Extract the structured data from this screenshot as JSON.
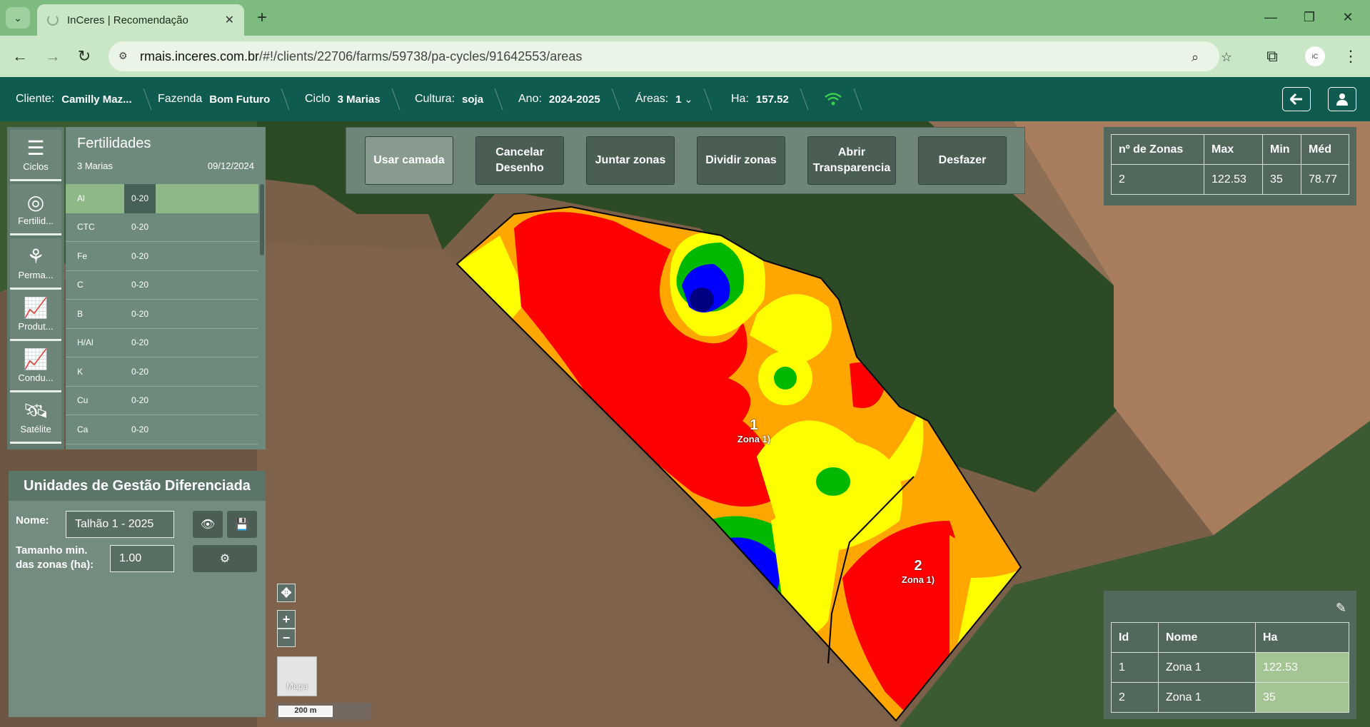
{
  "browser": {
    "tab_title": "InCeres | Recomendação",
    "url_host": "rmais.inceres.com.br",
    "url_path": "/#!/clients/22706/farms/59738/pa-cycles/91642553/areas"
  },
  "header": {
    "cliente_label": "Cliente:",
    "cliente_value": "Camilly Maz...",
    "fazenda_label": "Fazenda",
    "fazenda_value": "Bom Futuro",
    "ciclo_label": "Ciclo",
    "ciclo_value": "3 Marias",
    "cultura_label": "Cultura:",
    "cultura_value": "soja",
    "ano_label": "Ano:",
    "ano_value": "2024-2025",
    "areas_label": "Áreas:",
    "areas_value": "1",
    "ha_label": "Ha:",
    "ha_value": "157.52"
  },
  "sidebar": {
    "items": [
      {
        "label": "Ciclos",
        "icon": "list-icon"
      },
      {
        "label": "Fertilid...",
        "icon": "globe-icon"
      },
      {
        "label": "Perma...",
        "icon": "plants-icon"
      },
      {
        "label": "Produt...",
        "icon": "chart-icon"
      },
      {
        "label": "Condu...",
        "icon": "chart-icon"
      },
      {
        "label": "Satélite",
        "icon": "satellite-icon"
      }
    ]
  },
  "fertilidades": {
    "title": "Fertilidades",
    "subtitle": "3 Marias",
    "date": "09/12/2024",
    "rows": [
      {
        "name": "Al",
        "depth": "0-20"
      },
      {
        "name": "CTC",
        "depth": "0-20"
      },
      {
        "name": "Fe",
        "depth": "0-20"
      },
      {
        "name": "C",
        "depth": "0-20"
      },
      {
        "name": "B",
        "depth": "0-20"
      },
      {
        "name": "H/Al",
        "depth": "0-20"
      },
      {
        "name": "K",
        "depth": "0-20"
      },
      {
        "name": "Cu",
        "depth": "0-20"
      },
      {
        "name": "Ca",
        "depth": "0-20"
      }
    ]
  },
  "toolbar": {
    "usar_camada": "Usar camada",
    "cancelar_desenho_1": "Cancelar",
    "cancelar_desenho_2": "Desenho",
    "juntar_zonas": "Juntar zonas",
    "dividir_zonas": "Dividir zonas",
    "abrir_transparencia_1": "Abrir",
    "abrir_transparencia_2": "Transparencia",
    "desfazer": "Desfazer"
  },
  "summary": {
    "headers": [
      "nº de Zonas",
      "Max",
      "Min",
      "Méd"
    ],
    "values": [
      "2",
      "122.53",
      "35",
      "78.77"
    ]
  },
  "ugd": {
    "title": "Unidades de Gestão Diferenciada",
    "nome_label": "Nome:",
    "nome_value": "Talhão 1 - 2025",
    "tamanho_label_1": "Tamanho min.",
    "tamanho_label_2": "das zonas (ha):",
    "tamanho_value": "1.00"
  },
  "map": {
    "zone1_num": "1",
    "zone1_name": "Zona 1)",
    "zone2_num": "2",
    "zone2_name": "Zona 1)",
    "basemap_label": "Mapa",
    "scale_label": "200 m"
  },
  "zones_table": {
    "headers": [
      "Id",
      "Nome",
      "Ha"
    ],
    "rows": [
      {
        "id": "1",
        "nome": "Zona 1",
        "ha": "122.53"
      },
      {
        "id": "2",
        "nome": "Zona 1",
        "ha": "35"
      }
    ]
  },
  "colors": {
    "header": "#0f5b4f",
    "panel": "#6e8a7c",
    "selected_row": "#8fb887",
    "zone_high": "#ff0000",
    "zone_mid": "#ffa500",
    "zone_low": "#ffff00"
  }
}
